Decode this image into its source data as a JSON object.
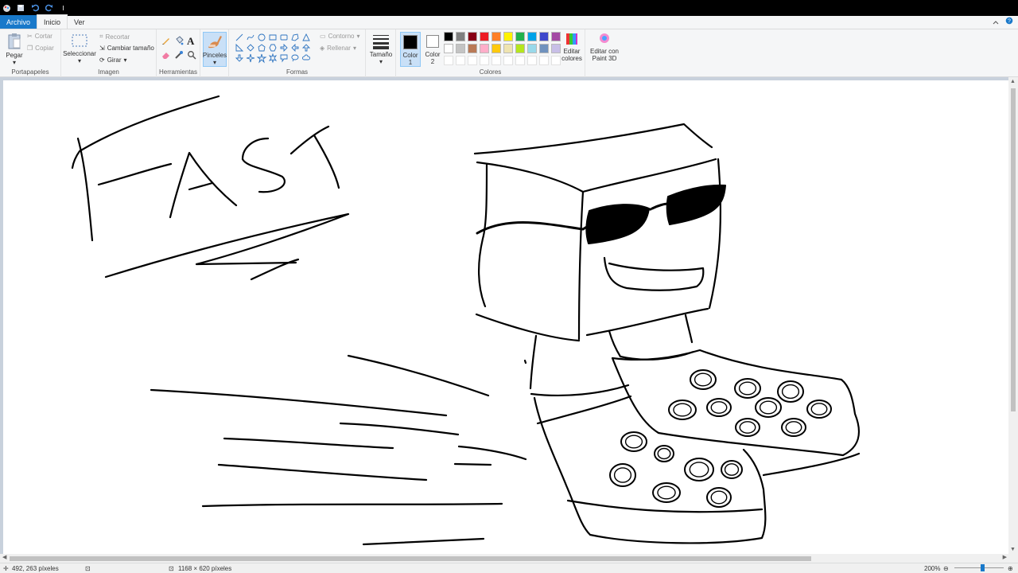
{
  "tabs": {
    "file": "Archivo",
    "home": "Inicio",
    "view": "Ver"
  },
  "clipboard": {
    "paste": "Pegar",
    "cut": "Cortar",
    "copy": "Copiar",
    "label": "Portapapeles"
  },
  "image": {
    "select": "Seleccionar",
    "crop": "Recortar",
    "resize": "Cambiar tamaño",
    "rotate": "Girar",
    "label": "Imagen"
  },
  "tools": {
    "label": "Herramientas"
  },
  "brushes": {
    "label": "Pinceles"
  },
  "shapes": {
    "outline": "Contorno",
    "fill": "Rellenar",
    "label": "Formas"
  },
  "size": {
    "label": "Tamaño"
  },
  "colors": {
    "color1": "Color 1",
    "color2": "Color 2",
    "label": "Colores",
    "edit": "Editar colores",
    "paint3d": "Editar con Paint 3D",
    "color1_value": "#000000",
    "color2_value": "#ffffff",
    "palette_row1": [
      "#000000",
      "#7f7f7f",
      "#880015",
      "#ed1c24",
      "#ff7f27",
      "#fff200",
      "#22b14c",
      "#00a2e8",
      "#3f48cc",
      "#a349a4"
    ],
    "palette_row2": [
      "#ffffff",
      "#c3c3c3",
      "#b97a57",
      "#ffaec9",
      "#ffc90e",
      "#efe4b0",
      "#b5e61d",
      "#99d9ea",
      "#7092be",
      "#c8bfe7"
    ]
  },
  "status": {
    "cursor_pos": "492, 263 píxeles",
    "canvas_size": "1168 × 620 píxeles",
    "zoom": "200%"
  }
}
